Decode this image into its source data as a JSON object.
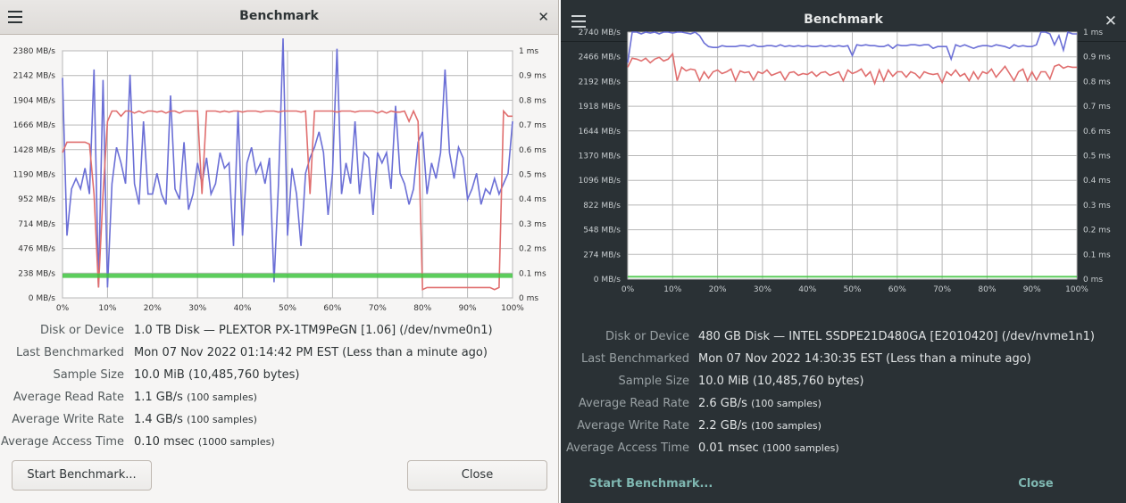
{
  "windows": [
    {
      "title": "Benchmark",
      "theme": "light",
      "labels": {
        "disk": "Disk or Device",
        "last": "Last Benchmarked",
        "sample": "Sample Size",
        "read": "Average Read Rate",
        "write": "Average Write Rate",
        "access": "Average Access Time"
      },
      "values": {
        "disk": "1.0 TB Disk — PLEXTOR PX-1TM9PeGN [1.06] (/dev/nvme0n1)",
        "last": "Mon 07 Nov 2022 01:14:42 PM EST (Less than a minute ago)",
        "sample": "10.0 MiB (10,485,760 bytes)",
        "read": "1.1 GB/s",
        "read_note": "(100 samples)",
        "write": "1.4 GB/s",
        "write_note": "(100 samples)",
        "access": "0.10 msec",
        "access_note": "(1000 samples)"
      },
      "buttons": {
        "start": "Start Benchmark...",
        "close": "Close"
      },
      "chart_data": {
        "type": "line",
        "x_ticks": [
          "0%",
          "10%",
          "20%",
          "30%",
          "40%",
          "50%",
          "60%",
          "70%",
          "80%",
          "90%",
          "100%"
        ],
        "y_ticks": [
          "0 MB/s",
          "238 MB/s",
          "476 MB/s",
          "714 MB/s",
          "952 MB/s",
          "1190 MB/s",
          "1428 MB/s",
          "1666 MB/s",
          "1904 MB/s",
          "2142 MB/s",
          "2380 MB/s"
        ],
        "y2_ticks": [
          "0 ms",
          "0.1 ms",
          "0.2 ms",
          "0.3 ms",
          "0.4 ms",
          "0.5 ms",
          "0.6 ms",
          "0.7 ms",
          "0.8 ms",
          "0.9 ms",
          "1 ms"
        ],
        "ylim": [
          0,
          2380
        ],
        "y2lim": [
          0,
          1
        ],
        "colors": {
          "read": "#6b6fd6",
          "write": "#e06e6e",
          "access": "#3fc43f"
        },
        "series": [
          {
            "key": "read",
            "y": [
              2120,
              600,
              1050,
              1150,
              1050,
              1250,
              1000,
              2200,
              100,
              2100,
              100,
              1100,
              1450,
              1300,
              1100,
              2150,
              1100,
              900,
              1700,
              1000,
              1000,
              1200,
              1000,
              900,
              1950,
              1050,
              950,
              1500,
              850,
              1000,
              1300,
              1100,
              1350,
              1000,
              1100,
              1400,
              1250,
              1300,
              500,
              1800,
              600,
              1300,
              1450,
              1200,
              1300,
              1100,
              1350,
              150,
              1100,
              2500,
              600,
              1250,
              1000,
              500,
              1200,
              1350,
              1450,
              1600,
              1400,
              800,
              1200,
              2400,
              1000,
              1300,
              1100,
              1700,
              1000,
              1400,
              1350,
              800,
              1400,
              1300,
              1400,
              1050,
              1850,
              1200,
              1100,
              900,
              1050,
              1500,
              1600,
              1000,
              1300,
              1150,
              1400,
              2200,
              1400,
              1150,
              1450,
              1350,
              950,
              1050,
              1200,
              900,
              1050,
              1000,
              1150,
              1000,
              1100,
              1200,
              1700
            ]
          },
          {
            "key": "write",
            "y": [
              1400,
              1500,
              1500,
              1500,
              1500,
              1500,
              1480,
              1000,
              100,
              1000,
              1700,
              1800,
              1800,
              1750,
              1800,
              1800,
              1780,
              1800,
              1780,
              1800,
              1800,
              1790,
              1800,
              1780,
              1800,
              1800,
              1780,
              1800,
              1800,
              1800,
              1800,
              1000,
              1800,
              1800,
              1800,
              1790,
              1800,
              1790,
              1800,
              1800,
              1790,
              1800,
              1800,
              1800,
              1790,
              1800,
              1800,
              1800,
              1790,
              1800,
              1800,
              1800,
              1800,
              1790,
              1800,
              1000,
              1800,
              1800,
              1800,
              1800,
              1800,
              1790,
              1800,
              1800,
              1800,
              1790,
              1800,
              1800,
              1800,
              1800,
              1780,
              1800,
              1780,
              1800,
              1790,
              1790,
              1800,
              1700,
              1800,
              1700,
              80,
              100,
              100,
              100,
              100,
              100,
              100,
              100,
              100,
              100,
              100,
              100,
              100,
              100,
              100,
              100,
              80,
              100,
              1800,
              1750,
              1750
            ]
          },
          {
            "key": "access",
            "y2": [
              0.09,
              0.09,
              0.09,
              0.09,
              0.09,
              0.09,
              0.09,
              0.09,
              0.09,
              0.09,
              0.09,
              0.09,
              0.09,
              0.09,
              0.09,
              0.09,
              0.09,
              0.09,
              0.09,
              0.09,
              0.09,
              0.09,
              0.09,
              0.09,
              0.09,
              0.09,
              0.09,
              0.09,
              0.09,
              0.09,
              0.09
            ]
          }
        ]
      }
    },
    {
      "title": "Benchmark",
      "theme": "dark",
      "labels": {
        "disk": "Disk or Device",
        "last": "Last Benchmarked",
        "sample": "Sample Size",
        "read": "Average Read Rate",
        "write": "Average Write Rate",
        "access": "Average Access Time"
      },
      "values": {
        "disk": "480 GB Disk — INTEL SSDPE21D480GA [E2010420] (/dev/nvme1n1)",
        "last": "Mon 07 Nov 2022 14:30:35 EST (Less than a minute ago)",
        "sample": "10.0 MiB (10,485,760 bytes)",
        "read": "2.6 GB/s",
        "read_note": "(100 samples)",
        "write": "2.2 GB/s",
        "write_note": "(100 samples)",
        "access": "0.01 msec",
        "access_note": "(1000 samples)"
      },
      "buttons": {
        "start": "Start Benchmark...",
        "close": "Close"
      },
      "chart_data": {
        "type": "line",
        "x_ticks": [
          "0%",
          "10%",
          "20%",
          "30%",
          "40%",
          "50%",
          "60%",
          "70%",
          "80%",
          "90%",
          "100%"
        ],
        "y_ticks": [
          "0 MB/s",
          "274 MB/s",
          "548 MB/s",
          "822 MB/s",
          "1096 MB/s",
          "1370 MB/s",
          "1644 MB/s",
          "1918 MB/s",
          "2192 MB/s",
          "2466 MB/s",
          "2740 MB/s"
        ],
        "y2_ticks": [
          "0 ms",
          "0.1 ms",
          "0.2 ms",
          "0.3 ms",
          "0.4 ms",
          "0.5 ms",
          "0.6 ms",
          "0.7 ms",
          "0.8 ms",
          "0.9 ms",
          "1 ms"
        ],
        "ylim": [
          0,
          2740
        ],
        "y2lim": [
          0,
          1
        ],
        "colors": {
          "read": "#6b6fd6",
          "write": "#e06e6e",
          "access": "#3fc43f"
        },
        "series": [
          {
            "key": "read",
            "y": [
              2400,
              2740,
              2740,
              2720,
              2740,
              2730,
              2740,
              2720,
              2740,
              2740,
              2730,
              2740,
              2740,
              2730,
              2720,
              2740,
              2700,
              2620,
              2580,
              2570,
              2570,
              2590,
              2580,
              2580,
              2580,
              2590,
              2590,
              2580,
              2600,
              2580,
              2580,
              2590,
              2590,
              2580,
              2600,
              2580,
              2590,
              2580,
              2590,
              2580,
              2590,
              2580,
              2580,
              2590,
              2580,
              2590,
              2580,
              2590,
              2580,
              2590,
              2480,
              2600,
              2590,
              2600,
              2590,
              2590,
              2580,
              2580,
              2600,
              2560,
              2600,
              2590,
              2590,
              2600,
              2600,
              2590,
              2600,
              2600,
              2560,
              2580,
              2580,
              2580,
              2440,
              2600,
              2580,
              2600,
              2580,
              2560,
              2580,
              2590,
              2590,
              2580,
              2600,
              2590,
              2580,
              2560,
              2600,
              2580,
              2590,
              2580,
              2580,
              2600,
              2740,
              2740,
              2720,
              2600,
              2700,
              2540,
              2740,
              2720,
              2720
            ]
          },
          {
            "key": "write",
            "y": [
              2350,
              2450,
              2440,
              2420,
              2450,
              2400,
              2440,
              2460,
              2420,
              2440,
              2500,
              2200,
              2350,
              2310,
              2330,
              2320,
              2200,
              2300,
              2230,
              2300,
              2320,
              2280,
              2300,
              2330,
              2200,
              2310,
              2290,
              2300,
              2210,
              2300,
              2280,
              2320,
              2260,
              2280,
              2300,
              2210,
              2290,
              2300,
              2260,
              2280,
              2270,
              2300,
              2250,
              2290,
              2300,
              2260,
              2280,
              2300,
              2200,
              2320,
              2280,
              2300,
              2330,
              2250,
              2300,
              2170,
              2320,
              2200,
              2320,
              2250,
              2300,
              2300,
              2240,
              2300,
              2280,
              2230,
              2300,
              2280,
              2270,
              2280,
              2180,
              2300,
              2260,
              2320,
              2250,
              2280,
              2200,
              2300,
              2220,
              2300,
              2280,
              2330,
              2240,
              2300,
              2360,
              2280,
              2200,
              2300,
              2330,
              2200,
              2300,
              2210,
              2300,
              2300,
              2220,
              2360,
              2380,
              2340,
              2360,
              2350,
              2350
            ]
          },
          {
            "key": "access",
            "y2": [
              0.01,
              0.01,
              0.01,
              0.01,
              0.01,
              0.01,
              0.01,
              0.01,
              0.01,
              0.01,
              0.01,
              0.01,
              0.01,
              0.01,
              0.01,
              0.01,
              0.01,
              0.01,
              0.01,
              0.01,
              0.01
            ]
          }
        ]
      }
    }
  ]
}
